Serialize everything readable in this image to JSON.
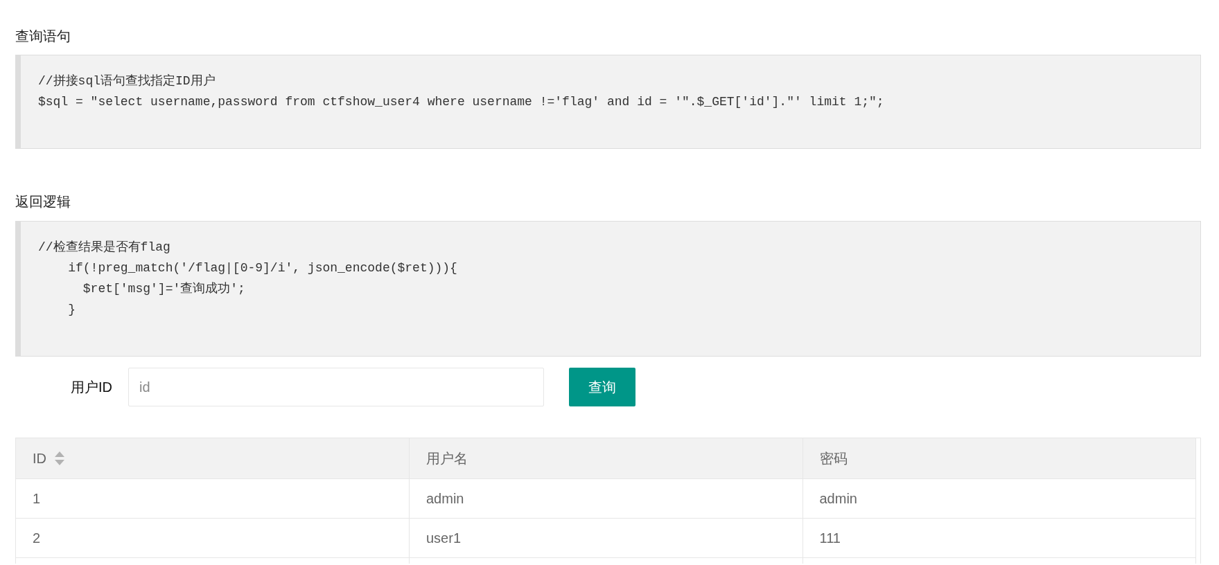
{
  "sections": [
    {
      "title": "查询语句",
      "code_lines": [
        "//拼接sql语句查找指定ID用户",
        "$sql = \"select username,password from ctfshow_user4 where username !='flag' and id = '\".$_GET['id'].\"' limit 1;\";"
      ]
    },
    {
      "title": "返回逻辑",
      "code_lines": [
        "//检查结果是否有flag",
        "    if(!preg_match('/flag|[0-9]/i', json_encode($ret))){",
        "      $ret['msg']='查询成功';",
        "    }"
      ]
    }
  ],
  "form": {
    "label": "用户ID",
    "input": {
      "placeholder": "id"
    },
    "button": "查询"
  },
  "table": {
    "columns": [
      {
        "label": "ID",
        "sortable": true
      },
      {
        "label": "用户名",
        "sortable": false
      },
      {
        "label": "密码",
        "sortable": false
      }
    ],
    "rows": [
      [
        "1",
        "admin",
        "admin"
      ],
      [
        "2",
        "user1",
        "111"
      ]
    ]
  }
}
